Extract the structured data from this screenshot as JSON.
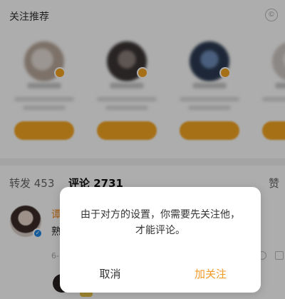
{
  "recommend": {
    "title": "关注推荐",
    "close_glyph": "©",
    "cards": [
      {
        "avatar_color": "#b8a79a"
      },
      {
        "avatar_color": "#5a5050"
      },
      {
        "avatar_color": "#3e5b86"
      },
      {
        "avatar_color": "#d7d2d0"
      }
    ]
  },
  "tabs": {
    "repost": "转发 453",
    "comment": "评论 2731",
    "like": "赞"
  },
  "comment": {
    "name": "谭",
    "text": "熟",
    "meta": "6-"
  },
  "dialog": {
    "line1": "由于对方的设置，你需要先关注他，",
    "line2": "才能评论。",
    "cancel": "取消",
    "follow": "加关注"
  },
  "colors": {
    "accent": "#f09a28",
    "verified": "#1e88e5"
  }
}
